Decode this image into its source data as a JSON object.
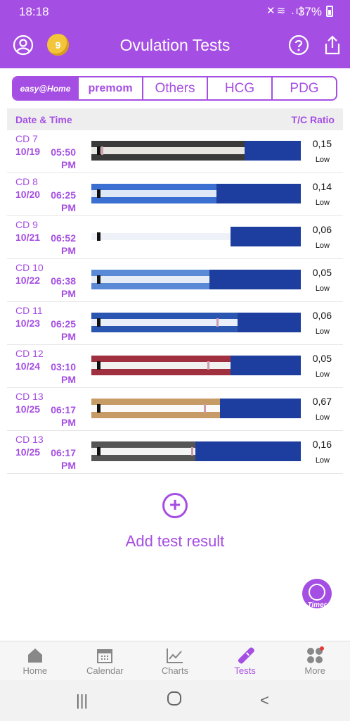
{
  "status_bar": {
    "time": "18:18",
    "battery": "37%"
  },
  "app_bar": {
    "title": "Ovulation Tests",
    "badge": "9"
  },
  "tabs": [
    {
      "label": "easy@Home",
      "active": true
    },
    {
      "label": "premom"
    },
    {
      "label": "Others"
    },
    {
      "label": "HCG"
    },
    {
      "label": "PDG"
    }
  ],
  "table": {
    "headers": {
      "date_time": "Date & Time",
      "ratio": "T/C Ratio"
    },
    "rows": [
      {
        "cd": "CD 7",
        "date": "10/19",
        "time": "05:50",
        "ampm": "PM",
        "ratio": "0,15",
        "level": "Low"
      },
      {
        "cd": "CD 8",
        "date": "10/20",
        "time": "06:25",
        "ampm": "PM",
        "ratio": "0,14",
        "level": "Low"
      },
      {
        "cd": "CD 9",
        "date": "10/21",
        "time": "06:52",
        "ampm": "PM",
        "ratio": "0,06",
        "level": "Low"
      },
      {
        "cd": "CD 10",
        "date": "10/22",
        "time": "06:38",
        "ampm": "PM",
        "ratio": "0,05",
        "level": "Low"
      },
      {
        "cd": "CD 11",
        "date": "10/23",
        "time": "06:25",
        "ampm": "PM",
        "ratio": "0,06",
        "level": "Low"
      },
      {
        "cd": "CD 12",
        "date": "10/24",
        "time": "03:10",
        "ampm": "PM",
        "ratio": "0,05",
        "level": "Low"
      },
      {
        "cd": "CD 13",
        "date": "10/25",
        "time": "06:17",
        "ampm": "PM",
        "ratio": "0,67",
        "level": "Low"
      },
      {
        "cd": "CD 13",
        "date": "10/25",
        "time": "06:17",
        "ampm": "PM",
        "ratio": "0,16",
        "level": "Low"
      }
    ]
  },
  "add_button": {
    "label": "Add test result"
  },
  "timer_button": {
    "label": "Timer"
  },
  "bottom_nav": [
    {
      "label": "Home",
      "icon": "home-icon"
    },
    {
      "label": "Calendar",
      "icon": "calendar-icon"
    },
    {
      "label": "Charts",
      "icon": "chart-icon"
    },
    {
      "label": "Tests",
      "icon": "test-strip-icon",
      "active": true
    },
    {
      "label": "More",
      "icon": "more-grid-icon"
    }
  ],
  "colors": {
    "accent": "#a54ee3",
    "strip_blue": "#1d3e9e"
  }
}
